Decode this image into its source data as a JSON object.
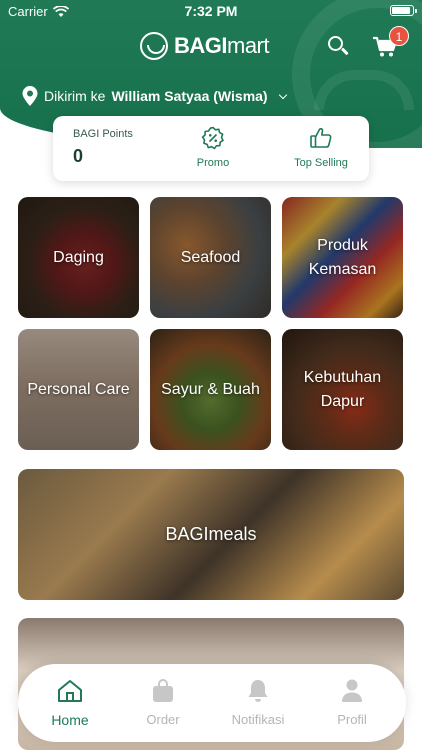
{
  "status_bar": {
    "carrier": "Carrier",
    "time": "7:32 PM",
    "battery_level": 0.95
  },
  "brand": {
    "bold": "BAGI",
    "thin": "mart"
  },
  "cart": {
    "count": "1"
  },
  "delivery": {
    "prefix": "Dikirim ke",
    "recipient": "William Satyaa (Wisma)"
  },
  "points": {
    "label": "BAGI Points",
    "value": "0"
  },
  "card_actions": [
    {
      "label": "Promo",
      "icon": "promo-icon"
    },
    {
      "label": "Top Selling",
      "icon": "thumbs-up-icon"
    }
  ],
  "categories": [
    {
      "label": "Daging"
    },
    {
      "label": "Seafood"
    },
    {
      "label": "Produk Kemasan"
    },
    {
      "label": "Personal Care"
    },
    {
      "label": "Sayur & Buah"
    },
    {
      "label": "Kebutuhan Dapur"
    }
  ],
  "banners": [
    {
      "label": "BAGImeals"
    },
    {
      "label": ""
    }
  ],
  "nav": [
    {
      "label": "Home",
      "icon": "home-icon",
      "active": true
    },
    {
      "label": "Order",
      "icon": "bag-icon",
      "active": false
    },
    {
      "label": "Notifikasi",
      "icon": "bell-icon",
      "active": false
    },
    {
      "label": "Profil",
      "icon": "user-icon",
      "active": false
    }
  ],
  "colors": {
    "primary": "#1f7a55",
    "badge": "#e8533f",
    "inactive": "#b5b5b5"
  }
}
